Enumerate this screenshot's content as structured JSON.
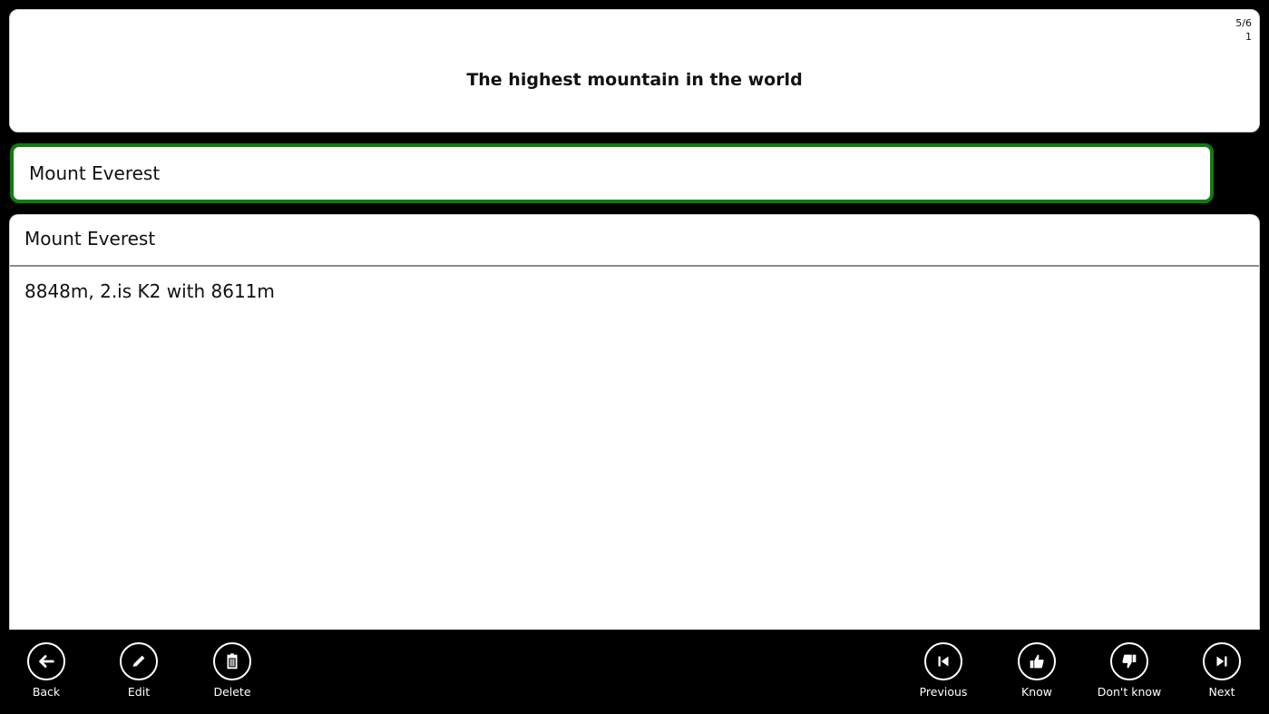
{
  "question": {
    "text": "The highest mountain in the world",
    "counter_position": "5/6",
    "counter_count": "1"
  },
  "answer_input": {
    "value": "Mount Everest",
    "border_color": "#0e7d0e"
  },
  "result": {
    "answer": "Mount Everest",
    "note": "8848m, 2.is K2 with 8611m"
  },
  "appbar": {
    "back": {
      "label": "Back",
      "icon": "arrow-left-icon"
    },
    "edit": {
      "label": "Edit",
      "icon": "pencil-icon"
    },
    "delete": {
      "label": "Delete",
      "icon": "trash-icon"
    },
    "previous": {
      "label": "Previous",
      "icon": "skip-previous-icon"
    },
    "know": {
      "label": "Know",
      "icon": "thumbs-up-icon"
    },
    "dont_know": {
      "label": "Don't know",
      "icon": "thumbs-down-icon"
    },
    "next": {
      "label": "Next",
      "icon": "skip-next-icon"
    }
  }
}
